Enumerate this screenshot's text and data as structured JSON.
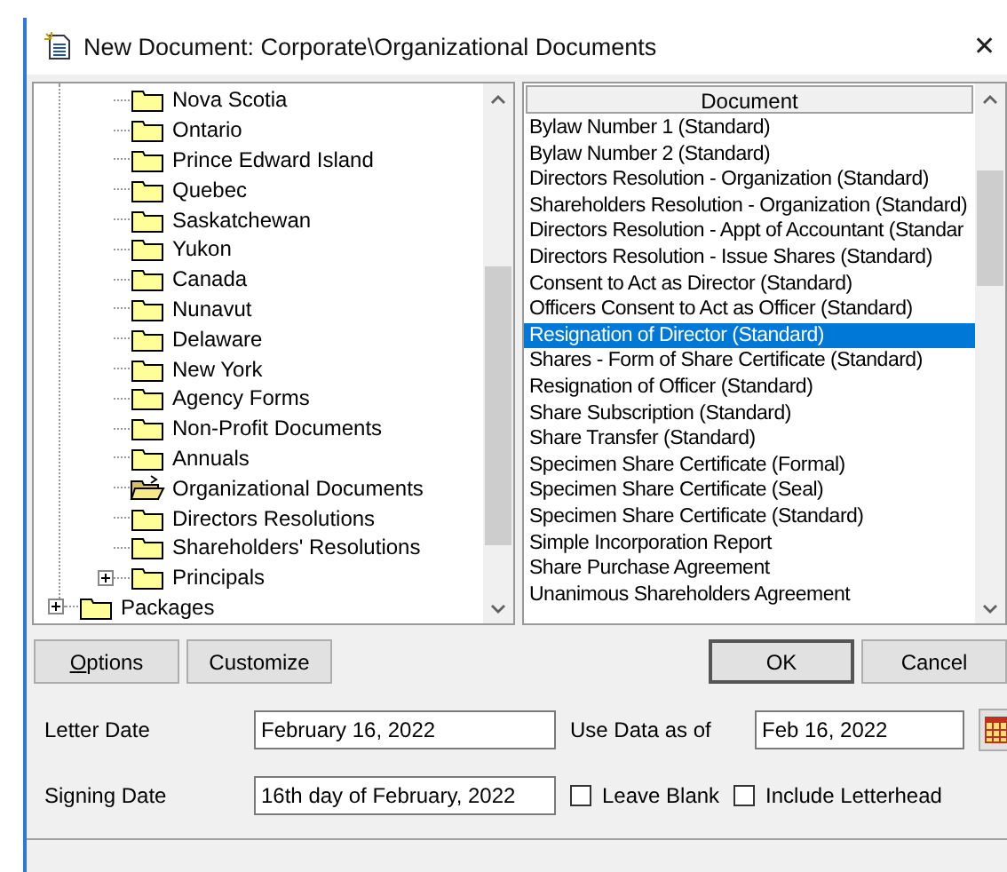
{
  "window": {
    "title": "New Document: Corporate\\Organizational Documents",
    "close": "✕"
  },
  "tree": {
    "items": [
      {
        "children": [
          {
            "label": "Nova Scotia",
            "open": false,
            "expandable": false
          },
          {
            "label": "Ontario",
            "open": false,
            "expandable": false
          },
          {
            "label": "Prince Edward Island",
            "open": false,
            "expandable": false
          },
          {
            "label": "Quebec",
            "open": false,
            "expandable": false
          },
          {
            "label": "Saskatchewan",
            "open": false,
            "expandable": false
          },
          {
            "label": "Yukon",
            "open": false,
            "expandable": false
          },
          {
            "label": "Canada",
            "open": false,
            "expandable": false
          },
          {
            "label": "Nunavut",
            "open": false,
            "expandable": false
          },
          {
            "label": "Delaware",
            "open": false,
            "expandable": false
          },
          {
            "label": "New York",
            "open": false,
            "expandable": false
          },
          {
            "label": "Agency Forms",
            "open": false,
            "expandable": false
          },
          {
            "label": "Non-Profit Documents",
            "open": false,
            "expandable": false
          },
          {
            "label": "Annuals",
            "open": false,
            "expandable": false
          },
          {
            "label": "Organizational Documents",
            "open": true,
            "expandable": false
          },
          {
            "label": "Directors Resolutions",
            "open": false,
            "expandable": false
          },
          {
            "label": "Shareholders' Resolutions",
            "open": false,
            "expandable": false
          },
          {
            "label": "Principals",
            "open": false,
            "expandable": true
          }
        ]
      },
      {
        "label": "Packages",
        "open": false,
        "expandable": true
      }
    ]
  },
  "documents": {
    "header": "Document",
    "rows": [
      {
        "label": "Bylaw Number 1 (Standard)",
        "selected": false
      },
      {
        "label": "Bylaw Number 2 (Standard)",
        "selected": false
      },
      {
        "label": "Directors Resolution - Organization (Standard)",
        "selected": false
      },
      {
        "label": "Shareholders Resolution - Organization (Standard)",
        "selected": false
      },
      {
        "label": "Directors Resolution - Appt of Accountant (Standar",
        "selected": false
      },
      {
        "label": "Directors Resolution - Issue Shares (Standard)",
        "selected": false
      },
      {
        "label": "Consent to Act as Director (Standard)",
        "selected": false
      },
      {
        "label": "Officers Consent to Act as Officer (Standard)",
        "selected": false
      },
      {
        "label": "Resignation of Director (Standard)",
        "selected": true
      },
      {
        "label": "Shares - Form of Share Certificate (Standard)",
        "selected": false
      },
      {
        "label": "Resignation of Officer (Standard)",
        "selected": false
      },
      {
        "label": "Share Subscription (Standard)",
        "selected": false
      },
      {
        "label": "Share Transfer (Standard)",
        "selected": false
      },
      {
        "label": "Specimen Share Certificate (Formal)",
        "selected": false
      },
      {
        "label": "Specimen Share Certificate (Seal)",
        "selected": false
      },
      {
        "label": "Specimen Share Certificate (Standard)",
        "selected": false
      },
      {
        "label": "Simple Incorporation Report",
        "selected": false
      },
      {
        "label": "Share Purchase Agreement",
        "selected": false
      },
      {
        "label": "Unanimous Shareholders Agreement",
        "selected": false
      }
    ]
  },
  "buttons": {
    "left": [
      "Options",
      "Customize"
    ],
    "right": [
      "OK",
      "Cancel"
    ]
  },
  "letter_date": {
    "label": "Letter Date",
    "value": "February 16, 2022"
  },
  "use_data_as_of": {
    "label": "Use Data as of",
    "value": "Feb 16, 2022"
  },
  "signing_date": {
    "label": "Signing Date",
    "value": "16th day of February, 2022"
  },
  "checkboxes": [
    {
      "label": "Leave Blank",
      "checked": false
    },
    {
      "label": "Include Letterhead",
      "checked": false
    }
  ]
}
